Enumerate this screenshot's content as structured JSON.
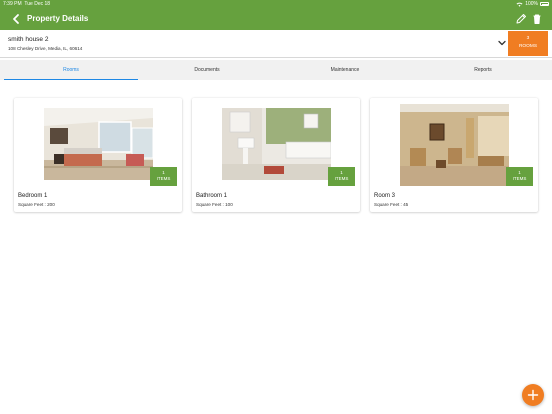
{
  "status_bar": {
    "time": "7:39 PM",
    "date": "Tue Dec 18",
    "battery": "100%"
  },
  "header": {
    "title": "Property Details",
    "back_icon": "chevron-left-icon",
    "edit_icon": "pencil-icon",
    "delete_icon": "trash-icon"
  },
  "property": {
    "name": "smith house 2",
    "address": "108 Chesley Drive, Media, IL, 60614",
    "rooms_count": "3",
    "rooms_label": "ROOMS"
  },
  "tabs": [
    {
      "label": "Rooms",
      "active": true
    },
    {
      "label": "Documents",
      "active": false
    },
    {
      "label": "Maintenance",
      "active": false
    },
    {
      "label": "Reports",
      "active": false
    }
  ],
  "rooms": [
    {
      "name": "Bedroom 1",
      "sqft": "Square Feet : 200",
      "items_count": "1",
      "items_label": "ITEMS"
    },
    {
      "name": "Bathroom 1",
      "sqft": "Square Feet : 100",
      "items_count": "1",
      "items_label": "ITEMS"
    },
    {
      "name": "Room 3",
      "sqft": "Square Feet : 45",
      "items_count": "1",
      "items_label": "ITEMS"
    }
  ],
  "colors": {
    "header_green": "#66a13e",
    "accent_orange": "#f07d22",
    "tab_active_blue": "#1e88e5"
  },
  "fab_icon": "plus-icon"
}
